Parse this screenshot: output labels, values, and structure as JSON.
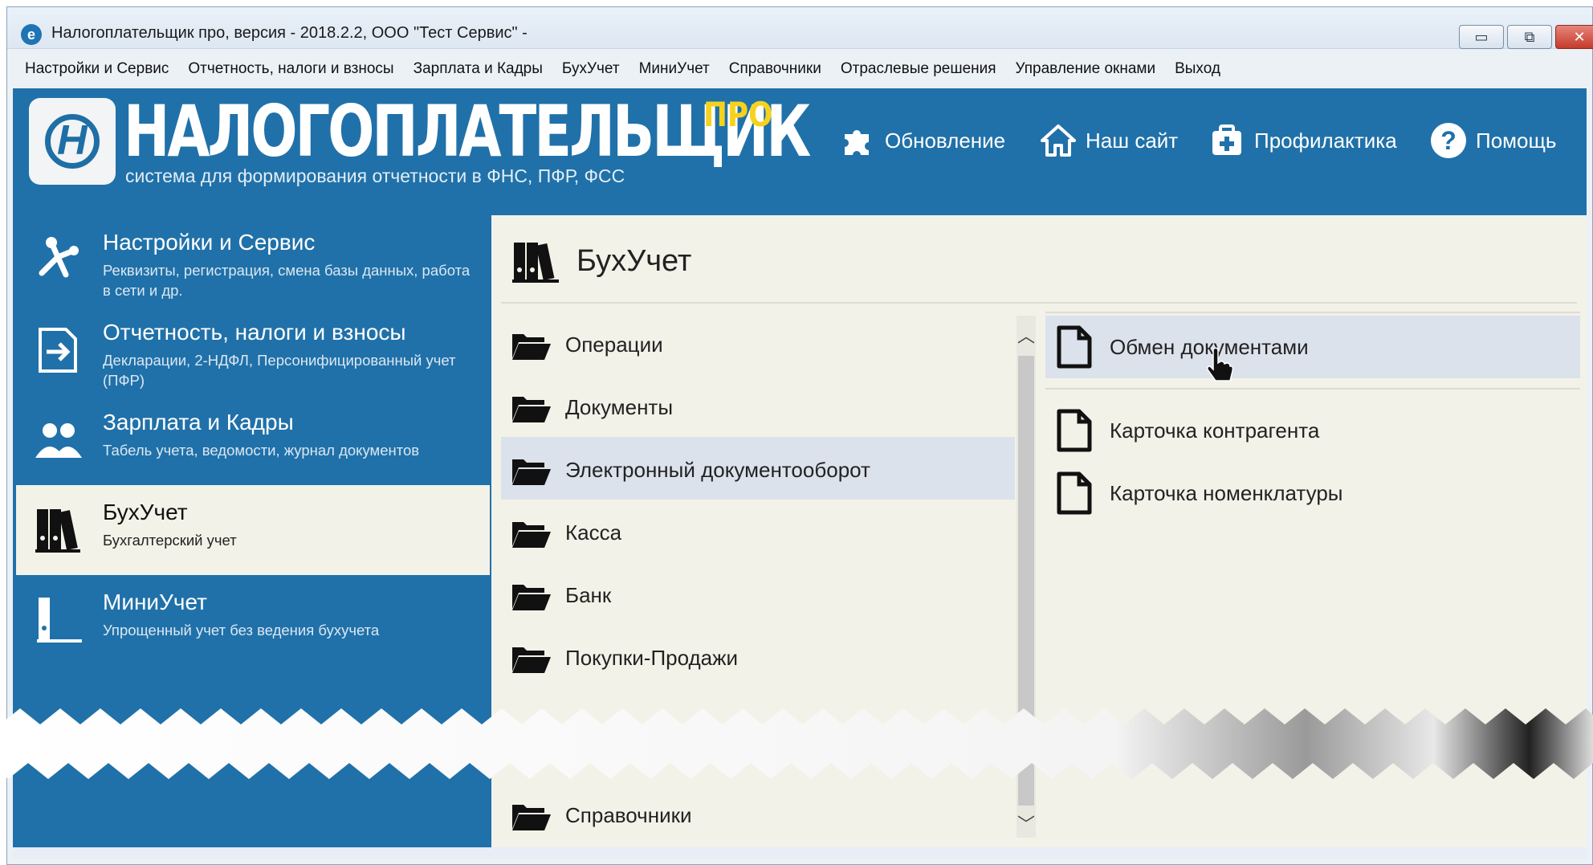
{
  "window": {
    "title": "Налогоплательщик про, версия - 2018.2.2, ООО \"Тест Сервис\"  -",
    "min_glyph": "▭",
    "max_glyph": "⧉",
    "close_glyph": "✕"
  },
  "menu": [
    "Настройки и Сервис",
    "Отчетность, налоги и взносы",
    "Зарплата и Кадры",
    "БухУчет",
    "МиниУчет",
    "Справочники",
    "Отраслевые решения",
    "Управление окнами",
    "Выход"
  ],
  "header": {
    "brand": "НАЛОГОПЛАТЕЛЬЩИК",
    "brand_suffix": "ПРО",
    "tagline": "система для формирования отчетности в ФНС, ПФР, ФСС",
    "links": {
      "update": "Обновление",
      "site": "Наш сайт",
      "prophylaxis": "Профилактика",
      "help": "Помощь"
    }
  },
  "sidebar": [
    {
      "title": "Настройки и Сервис",
      "desc": "Реквизиты, регистрация, смена базы данных, работа в сети и др."
    },
    {
      "title": "Отчетность, налоги и взносы",
      "desc": "Декларации, 2-НДФЛ, Персонифицированный учет (ПФР)"
    },
    {
      "title": "Зарплата и Кадры",
      "desc": "Табель учета, ведомости, журнал документов"
    },
    {
      "title": "БухУчет",
      "desc": "Бухгалтерский учет"
    },
    {
      "title": "МиниУчет",
      "desc": "Упрощенный учет без ведения бухучета"
    }
  ],
  "panel": {
    "title": "БухУчет",
    "folders": [
      "Операции",
      "Документы",
      "Электронный документооборот",
      "Касса",
      "Банк",
      "Покупки-Продажи",
      "Справочники"
    ],
    "documents": [
      "Обмен документами",
      "Карточка контрагента",
      "Карточка номенклатуры"
    ],
    "scroll_up": "︿",
    "scroll_down": "﹀"
  },
  "colors": {
    "main_blue": "#2071a9",
    "panel_bg": "#f2f2e8",
    "selected_bg": "#dce2ec",
    "brand_suffix": "#f7d21c"
  }
}
